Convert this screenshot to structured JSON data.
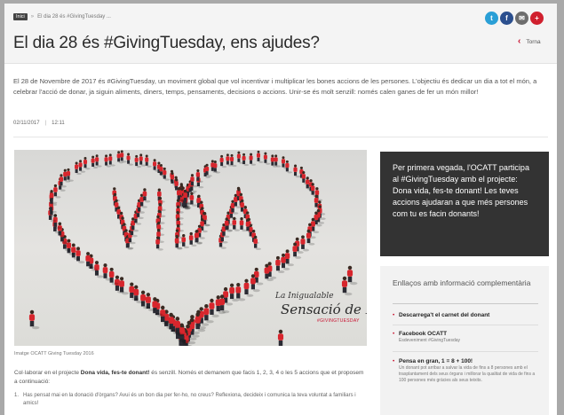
{
  "breadcrumb": {
    "home": "Inici",
    "current": "El dia 28 és #GivingTuesday ..."
  },
  "article": {
    "title": "El dia 28 és #GivingTuesday, ens ajudes?",
    "intro": "El 28 de Novembre de 2017 és #GivingTuesday, un moviment global que vol incentivar i multiplicar les bones accions de les persones. L'objectiu és dedicar un dia a tot el món, a celebrar l'acció de donar, ja siguin aliments, diners, temps, pensaments, decisions o accions. Unir-se és molt senzill: només calen ganes de fer un món millor!",
    "date": "02/11/2017",
    "time": "12:11",
    "image_caption": "Imatge OCATT Giving Tuesday 2016",
    "body_lead": "Col·laborar en el projecte ",
    "body_bold": "Dona vida, fes-te donant!",
    "body_rest": " és senzill. Només et demanem que facis 1, 2, 3, 4 o les 5 accions que et proposem a continuació:",
    "list": [
      {
        "num": "1.",
        "text": "Has pensat mai en la donació d'òrgans? Avui és un bon dia per fer-ho, no creus? Reflexiona, decideix i comunica la teva voluntat a familiars i amics!"
      }
    ]
  },
  "photo": {
    "word": "VIDA",
    "signature_line1": "La Inigualable",
    "signature_line2": "Sensació de Donar",
    "signature_tag": "#GIVINGTUESDAY"
  },
  "social": {
    "twitter_glyph": "t",
    "facebook_glyph": "f",
    "mail_glyph": "✉",
    "plus_glyph": "+"
  },
  "back": {
    "label": "Torna"
  },
  "promo": {
    "text": "Per primera vegada, l'OCATT participa al #GivingTuesday amb el projecte: Dona vida, fes-te donant! Les teves accions ajudaran a que més persones com tu es facin donants!"
  },
  "links": {
    "title": "Enllaços amb informació complementària",
    "items": [
      {
        "title": "Descarrega't el carnet del donant",
        "sub": ""
      },
      {
        "title": "Facebook OCATT",
        "sub": "Esdeveniment #GivingTuesday"
      },
      {
        "title": "Pensa en gran, 1 = 8 + 100!",
        "sub": "Un donant pot arribar a salvar la vida de fins a 8 persones amb el trasplantament dels seus òrgans i millorar la qualitat de vida de fins a 100 persones més gràcies als seus teixits."
      }
    ]
  },
  "colors": {
    "accent": "#c8102e",
    "promo_bg": "#333333",
    "twitter": "#2a9fd6",
    "facebook": "#2b4f8e",
    "shirt_red": "#d7262d"
  }
}
